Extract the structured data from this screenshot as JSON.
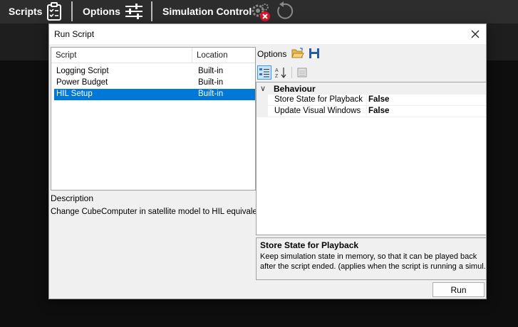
{
  "toolbar": {
    "scripts_label": "Scripts",
    "options_label": "Options",
    "simulation_label": "Simulation Control",
    "icons": [
      "clipboard-checklist-icon",
      "sliders-icon",
      "gears-error-icon",
      "reset-icon"
    ]
  },
  "dialog": {
    "title": "Run Script",
    "list": {
      "columns": [
        "Script",
        "Location"
      ],
      "rows": [
        {
          "script": "Logging Script",
          "location": "Built-in",
          "selected": false
        },
        {
          "script": "Power Budget",
          "location": "Built-in",
          "selected": false
        },
        {
          "script": "HIL Setup",
          "location": "Built-in",
          "selected": true
        }
      ]
    },
    "description": {
      "title": "Description",
      "text": "Change CubeComputer in satellite model to HIL equivalent."
    },
    "options": {
      "label": "Options",
      "category": "Behaviour",
      "properties": [
        {
          "name": "Store State for Playback",
          "value": "False"
        },
        {
          "name": "Update Visual Windows",
          "value": "False"
        }
      ]
    },
    "help": {
      "title": "Store State for Playback",
      "line1": "Keep simulation state in memory, so that it can be played back",
      "line2": "after the script ended. (applies when the script is running a simul..."
    },
    "run_label": "Run"
  },
  "colors": {
    "selection": "#0078d7",
    "error_badge": "#d9152b",
    "toolbar_bg": "#2d2d2d"
  }
}
